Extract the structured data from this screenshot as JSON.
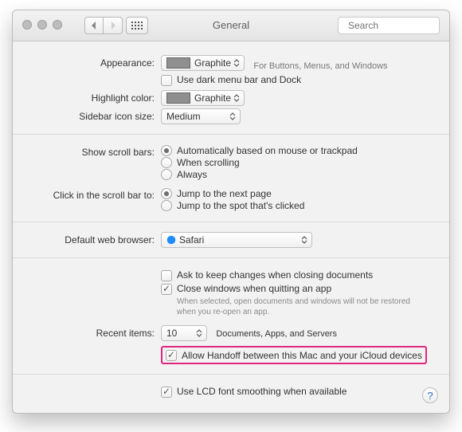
{
  "window": {
    "title": "General"
  },
  "toolbar": {
    "search_placeholder": "Search"
  },
  "appearance": {
    "label": "Appearance:",
    "value": "Graphite",
    "hint": "For Buttons, Menus, and Windows",
    "dark_mode_label": "Use dark menu bar and Dock",
    "dark_mode_checked": false
  },
  "highlight": {
    "label": "Highlight color:",
    "value": "Graphite"
  },
  "sidebar": {
    "label": "Sidebar icon size:",
    "value": "Medium"
  },
  "scrollbars": {
    "label": "Show scroll bars:",
    "options": [
      "Automatically based on mouse or trackpad",
      "When scrolling",
      "Always"
    ],
    "selected": 0
  },
  "scrollclick": {
    "label": "Click in the scroll bar to:",
    "options": [
      "Jump to the next page",
      "Jump to the spot that's clicked"
    ],
    "selected": 0
  },
  "browser": {
    "label": "Default web browser:",
    "value": "Safari"
  },
  "documents": {
    "ask_label": "Ask to keep changes when closing documents",
    "ask_checked": false,
    "close_label": "Close windows when quitting an app",
    "close_checked": true,
    "close_note": "When selected, open documents and windows will not be restored when you re-open an app."
  },
  "recent": {
    "label": "Recent items:",
    "value": "10",
    "suffix": "Documents, Apps, and Servers"
  },
  "handoff": {
    "label": "Allow Handoff between this Mac and your iCloud devices",
    "checked": true
  },
  "lcd": {
    "label": "Use LCD font smoothing when available",
    "checked": true
  },
  "help": {
    "label": "?"
  }
}
